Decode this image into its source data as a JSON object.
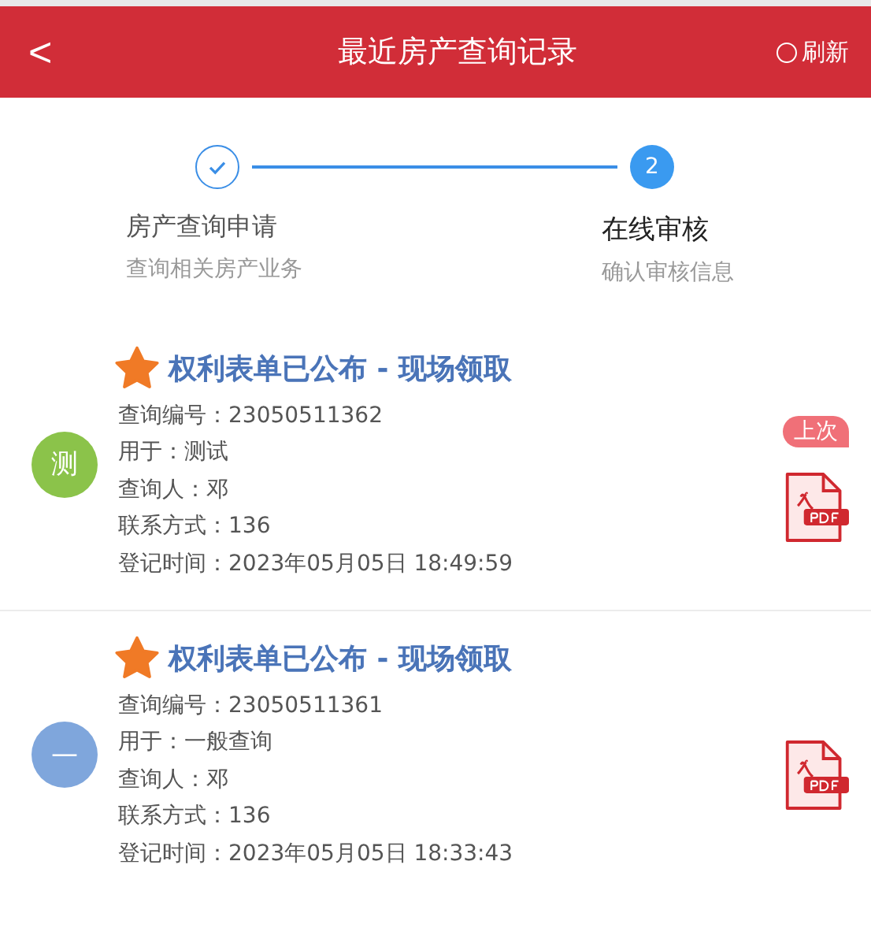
{
  "header": {
    "back": "<",
    "title": "最近房产查询记录",
    "refresh": "刷新"
  },
  "steps": [
    {
      "title": "房产查询申请",
      "subtitle": "查询相关房产业务",
      "completed": true,
      "selected": false
    },
    {
      "title": "在线审核",
      "subtitle": "确认审核信息",
      "completed": false,
      "selected": true,
      "number": "2"
    }
  ],
  "records": [
    {
      "title": "权利表单已公布 - 现场领取",
      "avatar": "测",
      "color": "#8bc34a",
      "badge": "上次",
      "fields": [
        {
          "label": "查询编号：",
          "value": "23050511362"
        },
        {
          "label": "用于：",
          "value": "测试"
        },
        {
          "label": "查询人：",
          "value": "邓"
        },
        {
          "label": "联系方式：",
          "value": "136"
        },
        {
          "label": "登记时间：",
          "value": "2023年05月05日 18:49:59"
        }
      ]
    },
    {
      "title": "权利表单已公布 - 现场领取",
      "avatar": "—",
      "color": "#7fa6dc",
      "fields": [
        {
          "label": "查询编号：",
          "value": "23050511361"
        },
        {
          "label": "用于：",
          "value": "一般查询"
        },
        {
          "label": "查询人：",
          "value": "邓"
        },
        {
          "label": "联系方式：",
          "value": "136"
        },
        {
          "label": "登记时间：",
          "value": "2023年05月05日 18:33:43"
        }
      ]
    }
  ]
}
